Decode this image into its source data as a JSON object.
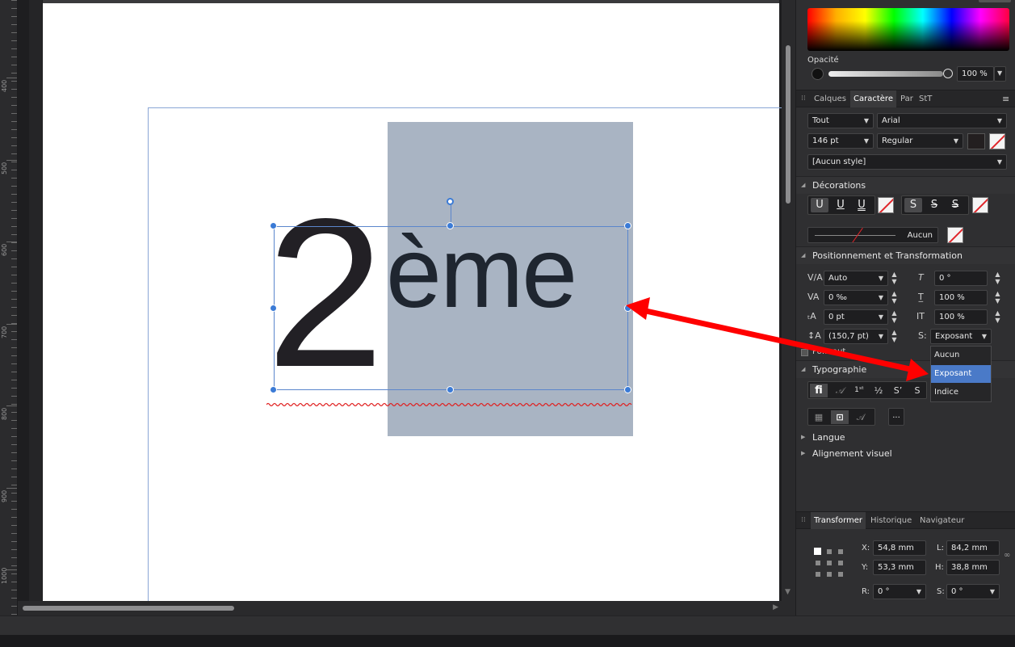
{
  "ruler": {
    "labels": [
      "400",
      "500",
      "600",
      "700",
      "800",
      "900",
      "1000"
    ]
  },
  "color": {
    "opacity_label": "Opacité",
    "opacity_value": "100 %"
  },
  "tabs_top": [
    "Calques",
    "Caractère",
    "Par",
    "StT"
  ],
  "character": {
    "scope": "Tout",
    "font": "Arial",
    "size": "146 pt",
    "weight": "Regular",
    "style": "[Aucun style]"
  },
  "decorations": {
    "title": "Décorations",
    "underline_buttons": [
      "U",
      "U",
      "U"
    ],
    "strike_buttons": [
      "S",
      "S",
      "S"
    ],
    "line_value": "Aucun"
  },
  "positioning": {
    "title": "Positionnement et Transformation",
    "kerning": "Auto",
    "tracking": "0 ‰",
    "baseline": "0 pt",
    "leading": "(150,7 pt)",
    "italic_angle": "0 °",
    "vertical_scale": "100 %",
    "horizontal_scale": "100 %",
    "script_label": "S:",
    "script_value": "Exposant",
    "overlapped_label": "Po… aut"
  },
  "script_dropdown": {
    "options": [
      "Aucun",
      "Exposant",
      "Indice"
    ],
    "selected": "Exposant"
  },
  "typography": {
    "title": "Typographie",
    "more": "..."
  },
  "collapsed_sections": [
    "Langue",
    "Alignement visuel"
  ],
  "tabs_bottom": [
    "Transformer",
    "Historique",
    "Navigateur"
  ],
  "transform": {
    "x_label": "X:",
    "x": "54,8 mm",
    "y_label": "Y:",
    "y": "53,3 mm",
    "w_label": "L:",
    "w": "84,2 mm",
    "h_label": "H:",
    "h": "38,8 mm",
    "r_label": "R:",
    "r": "0 °",
    "s_label": "S:",
    "s": "0 °"
  },
  "canvas": {
    "digit": "2",
    "suffix": "ème"
  },
  "colors": {
    "accent": "#4a7ac8",
    "selection_handle": "#3b7bd6",
    "arrow": "#ff0000"
  }
}
